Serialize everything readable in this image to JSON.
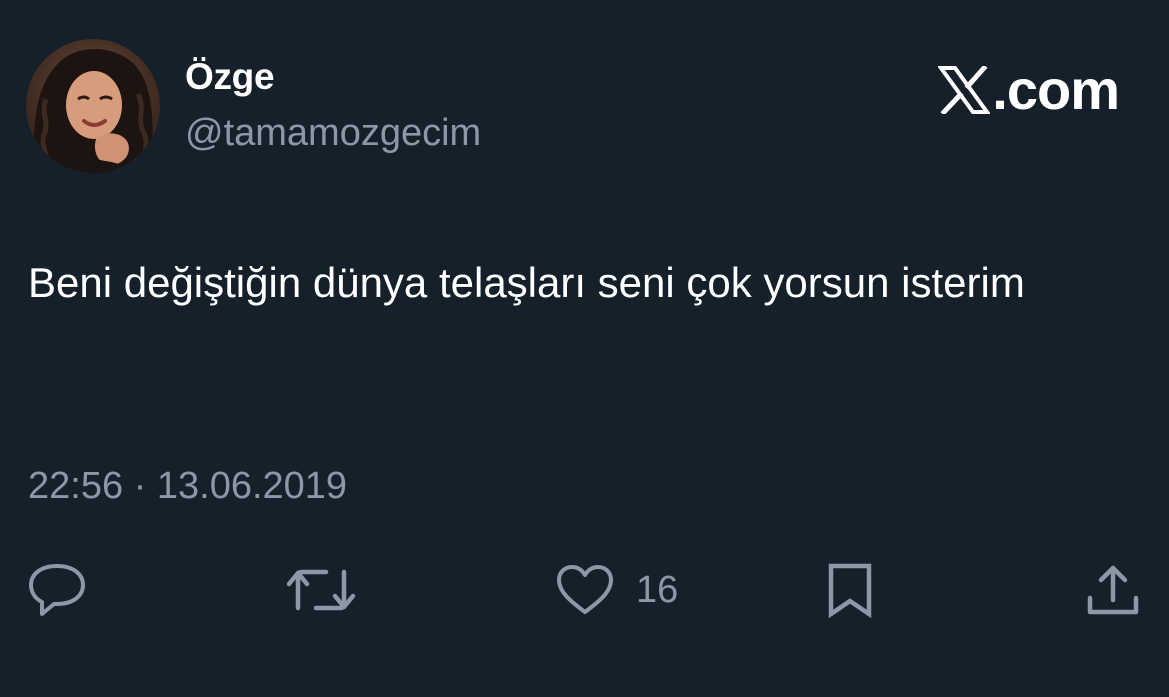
{
  "author": {
    "display_name": "Özge",
    "handle": "@tamamozgecim"
  },
  "brand": {
    "icon": "x-logo-icon",
    "text": ".com"
  },
  "tweet": {
    "text": "Beni değiştiğin dünya telaşları seni çok yorsun isterim",
    "time": "22:56",
    "separator": "·",
    "date": "13.06.2019"
  },
  "actions": {
    "reply": {
      "icon": "reply-icon"
    },
    "retweet": {
      "icon": "retweet-icon"
    },
    "like": {
      "icon": "heart-icon",
      "count": "16"
    },
    "bookmark": {
      "icon": "bookmark-icon"
    },
    "share": {
      "icon": "share-icon"
    }
  },
  "colors": {
    "background": "#15202b",
    "primary_text": "#ffffff",
    "secondary_text": "#8b98a5"
  }
}
